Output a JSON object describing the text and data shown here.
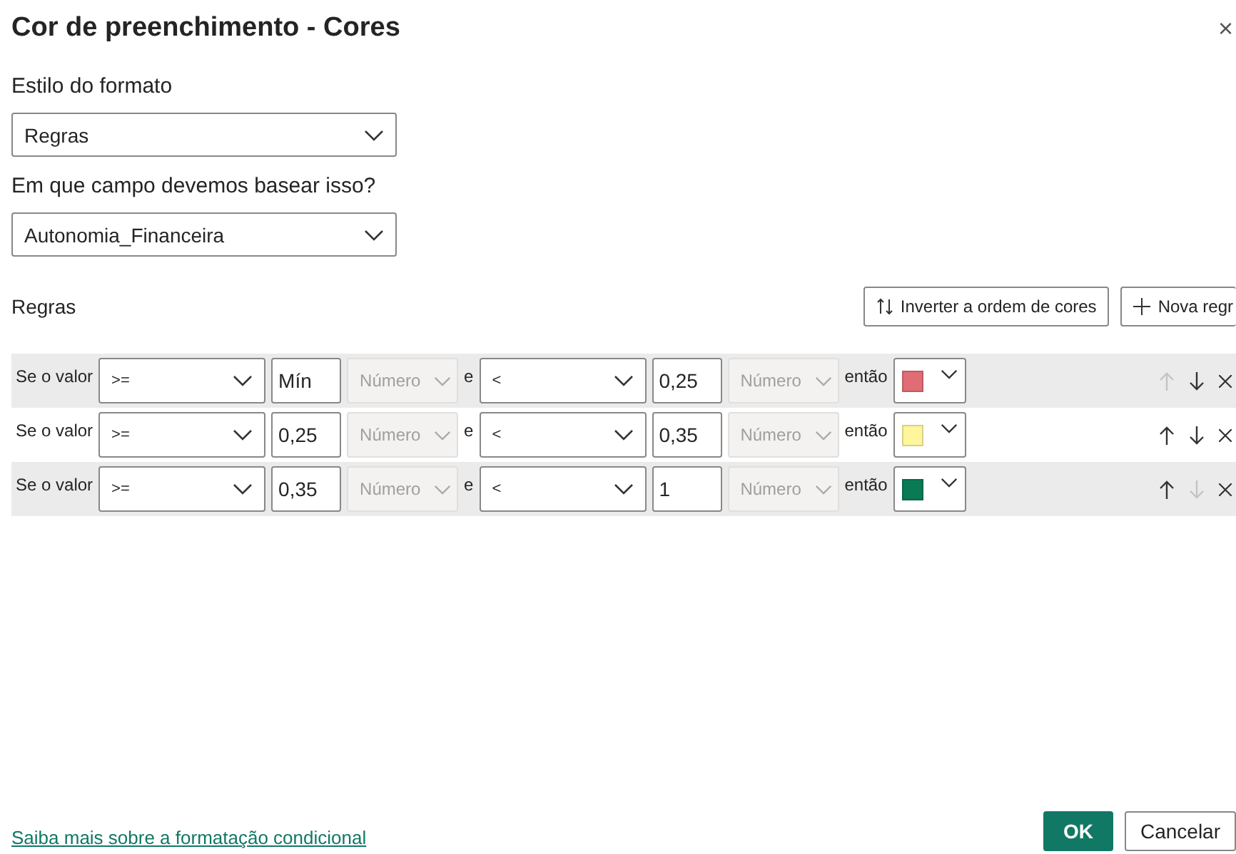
{
  "dialog": {
    "title": "Cor de preenchimento - Cores",
    "close": "×"
  },
  "format_style": {
    "label": "Estilo do formato",
    "value": "Regras"
  },
  "field": {
    "label": "Em que campo devemos basear isso?",
    "value": "Autonomia_Financeira"
  },
  "rules": {
    "label": "Regras",
    "buttons": [
      {
        "kind": "reverse",
        "label": "Inverter a ordem de cores"
      },
      {
        "kind": "add",
        "label": "Nova regr"
      }
    ],
    "rows": [
      {
        "prefix": "Se o valor",
        "op1": ">=",
        "value1": "Mín",
        "type1": "Número",
        "joiner": "e",
        "op2": "<",
        "value2": "0,25",
        "type2": "Número",
        "then": "então",
        "color": "#e06c75",
        "up_enabled": false,
        "down_enabled": true
      },
      {
        "prefix": "Se o valor",
        "op1": ">=",
        "value1": "0,25",
        "type1": "Número",
        "joiner": "e",
        "op2": "<",
        "value2": "0,35",
        "type2": "Número",
        "then": "então",
        "color": "#fff59d",
        "up_enabled": true,
        "down_enabled": true
      },
      {
        "prefix": "Se o valor",
        "op1": ">=",
        "value1": "0,35",
        "type1": "Número",
        "joiner": "e",
        "op2": "<",
        "value2": "1",
        "type2": "Número",
        "then": "então",
        "color": "#0a7a54",
        "up_enabled": true,
        "down_enabled": false
      }
    ]
  },
  "footer": {
    "link": "Saiba mais sobre a formatação condicional",
    "buttons": [
      {
        "kind": "primary",
        "label": "OK"
      },
      {
        "kind": "secondary",
        "label": "Cancelar"
      }
    ]
  }
}
